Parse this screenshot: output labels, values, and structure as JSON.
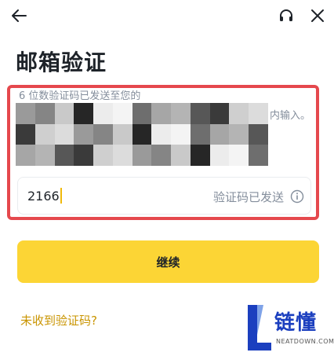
{
  "header": {
    "title": "邮箱验证"
  },
  "verification": {
    "hint_prefix": "6 位数验证码已发送至您的",
    "hint_suffix": "内输入。",
    "code_value": "2166",
    "status_text": "验证码已发送"
  },
  "actions": {
    "continue_label": "继续",
    "resend_label": "未收到验证码?"
  },
  "watermark": {
    "brand": "链懂",
    "domain": "NEATDOWN.COM"
  },
  "icons": {
    "back": "arrow-left-icon",
    "support": "headset-icon",
    "close": "close-icon",
    "info": "info-icon"
  },
  "colors": {
    "primary_button": "#fcd535",
    "link": "#c99400",
    "highlight_border": "#e5484d",
    "secondary_text": "#848e9c",
    "caret": "#f0b90b"
  }
}
